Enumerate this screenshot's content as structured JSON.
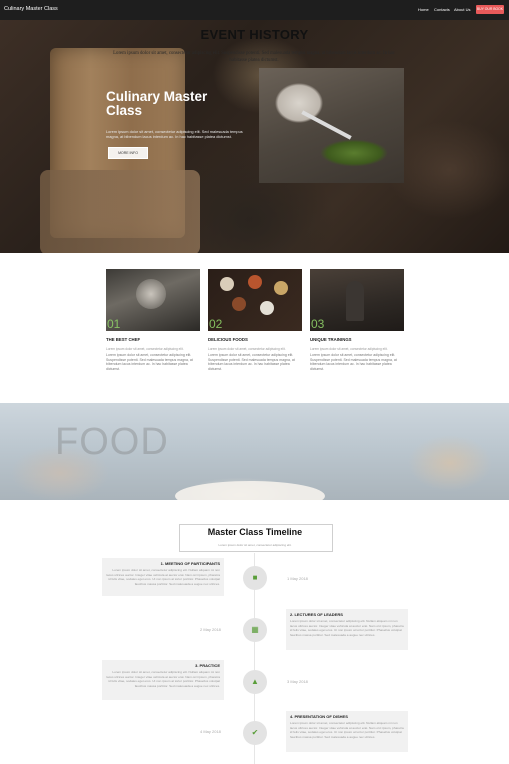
{
  "header": {
    "brand": "Culinary Master Class",
    "nav": [
      "Home",
      "Contacts",
      "About Us"
    ],
    "cta": "BUY OUR BOOK"
  },
  "hero": {
    "title": "Culinary Master Class",
    "text": "Lorem ipsum dolor sit amet, consectetur adipiscing elit. Sed malesuada tempus magna, at bibendum lacus interdum ac. In hac habitasse platea dictumst.",
    "button": "MORE INFO"
  },
  "features": [
    {
      "num": "01",
      "title": "THE BEST CHEF",
      "sub": "Lorem ipsum dolor sit amet, consectetur adipiscing elit.",
      "body": "Lorem ipsum dolor sit amet, consectetur adipiscing elit. Suspendisse potenti. Sed malesuada tempus magna, at bibendum lacus interdum ac. In hac habitasse platea dictumst."
    },
    {
      "num": "02",
      "title": "DELICIOUS FOODS",
      "sub": "Lorem ipsum dolor sit amet, consectetur adipiscing elit.",
      "body": "Lorem ipsum dolor sit amet, consectetur adipiscing elit. Suspendisse potenti. Sed malesuada tempus magna, at bibendum lacus interdum ac. In hac habitasse platea dictumst."
    },
    {
      "num": "03",
      "title": "UNIQUE TRAININGS",
      "sub": "Lorem ipsum dolor sit amet, consectetur adipiscing elit.",
      "body": "Lorem ipsum dolor sit amet, consectetur adipiscing elit. Suspendisse potenti. Sed malesuada tempus magna, at bibendum lacus interdum ac. In hac habitasse platea dictumst."
    }
  ],
  "event": {
    "ghost": "FOOD",
    "title": "EVENT HISTORY",
    "text": "Lorem ipsum dolor sit amet, consectetur adipiscing elit. Suspendisse potenti. Sed malesuada tempus magna, at bibendum lacus interdum ac. In hac habitasse platea dictumst."
  },
  "timeline": {
    "title": "Master Class Timeline",
    "subtitle": "Lorem ipsum dolor sit amet, consectetur adipiscing elit.",
    "items": [
      {
        "title": "1. MEETING OF PARTICIPANTS",
        "date": "1 May 2018",
        "icon": "chat-icon",
        "body": "Lorem ipsum dolor sit amet, consectetur adipiscing elit. Nullam aliquam mi non lacus ultrices auctor. Integer vitae vehicula at auctor erat. Nam orci ipsum, pharetra id felis vitae, sodales eget eros. Ut non ipsum at tortor porttitor. Phasellus volutpat faucibus massa porttitor. Sed malesuada a augue nec ultrices."
      },
      {
        "title": "2. LECTURES OF LEADERS",
        "date": "2 May 2018",
        "icon": "document-icon",
        "body": "Lorem ipsum dolor sit amet, consectetur adipiscing elit. Nullam aliquam mi non lacus ultrices auctor. Integer vitae vehicula at auctor erat. Nam orci ipsum, pharetra id felis vitae, sodales eget eros. Ut non ipsum at tortor porttitor. Phasellus volutpat faucibus massa porttitor. Sed malesuada a augue nec ultrices."
      },
      {
        "title": "3. PRACTICE",
        "date": "3 May 2018",
        "icon": "chef-icon",
        "body": "Lorem ipsum dolor sit amet, consectetur adipiscing elit. Nullam aliquam mi non lacus ultrices auctor. Integer vitae vehicula at auctor erat. Nam orci ipsum, pharetra id felis vitae, sodales eget eros. Ut non ipsum at tortor porttitor. Phasellus volutpat faucibus massa porttitor. Sed malesuada a augue nec ultrices."
      },
      {
        "title": "4. PRESENTATION OF DISHES",
        "date": "4 May 2018",
        "icon": "thumbs-up-icon",
        "body": "Lorem ipsum dolor sit amet, consectetur adipiscing elit. Nullam aliquam mi non lacus ultrices auctor. Integer vitae vehicula at auctor erat. Nam orci ipsum, pharetra id felis vitae, sodales eget eros. Ut non ipsum at tortor porttitor. Phasellus volutpat faucibus massa porttitor. Sed malesuada a augue nec ultrices."
      }
    ]
  },
  "colors": {
    "accent": "#e85a5a",
    "green": "#8ecf67",
    "header": "#1e1e1e"
  }
}
